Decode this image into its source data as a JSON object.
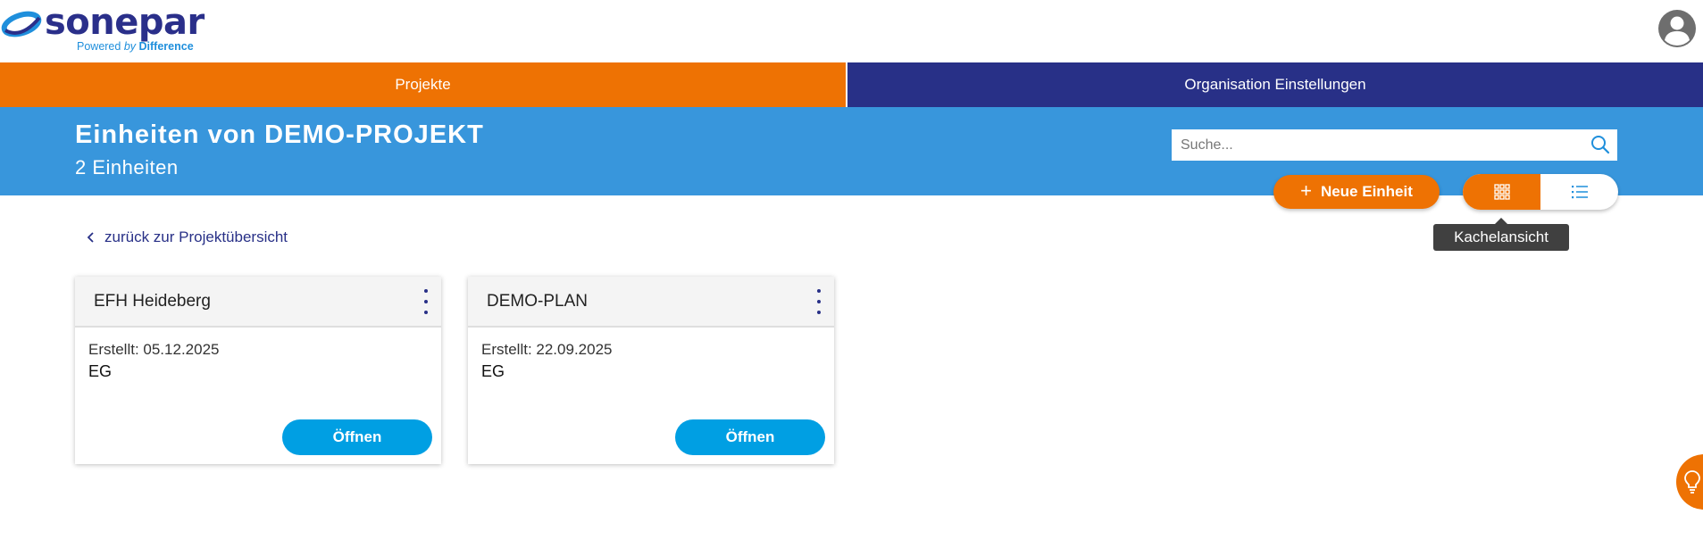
{
  "brand": {
    "name": "sonepar",
    "tagline_prefix": "Powered",
    "tagline_by": "by",
    "tagline_suffix": "Difference",
    "colors": {
      "orange": "#ee7203",
      "navy": "#283087",
      "blue": "#3896dc",
      "button_blue": "#009fe3"
    }
  },
  "user_menu": {
    "icon": "account-circle-icon"
  },
  "nav": {
    "tabs": [
      {
        "label": "Projekte",
        "active": true
      },
      {
        "label": "Organisation Einstellungen",
        "active": false
      }
    ]
  },
  "header": {
    "title": "Einheiten von DEMO-PROJEKT",
    "subtitle": "2 Einheiten"
  },
  "search": {
    "placeholder": "Suche...",
    "value": "",
    "icon": "search-icon"
  },
  "actions": {
    "new_unit_label": "Neue Einheit",
    "view_toggle": {
      "options": [
        {
          "name": "tile-view",
          "icon": "grid-icon",
          "active": true
        },
        {
          "name": "list-view",
          "icon": "list-icon",
          "active": false
        }
      ],
      "tooltip": "Kachelansicht"
    }
  },
  "back_link": {
    "label": "zurück zur Projektübersicht",
    "icon": "chevron-left-icon"
  },
  "cards": [
    {
      "title": "EFH Heideberg",
      "created": "Erstellt: 05.12.2025",
      "floor": "EG",
      "open_label": "Öffnen"
    },
    {
      "title": "DEMO-PLAN",
      "created": "Erstellt: 22.09.2025",
      "floor": "EG",
      "open_label": "Öffnen"
    }
  ],
  "help_fab": {
    "icon": "lightbulb-icon"
  }
}
